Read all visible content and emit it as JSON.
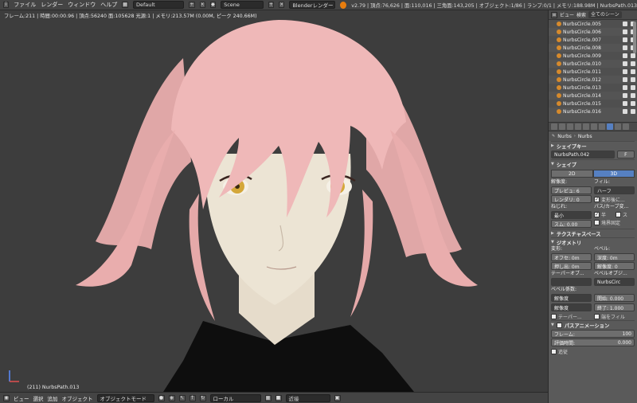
{
  "top": {
    "menus": [
      "ファイル",
      "レンダー",
      "ウィンドウ",
      "ヘルプ"
    ],
    "layout": "Default",
    "scene": "Scene",
    "engine": "Blenderレンダー",
    "stats": "v2.79 | 頂点:76,626 | 面:110,016 | 三角面:143,205 | オブジェクト:1/86 | ランプ:0/1 | メモリ:188.98M | NurbsPath.013"
  },
  "viewport": {
    "info": "フレーム:211 | 時間:00:00.96 | 頂点:56240 面:105628 光源:1 | メモリ:213.57M (0.00M, ピーク 240.66M)",
    "object_label": "(211) NurbsPath.013"
  },
  "bottom": {
    "menus": [
      "ビュー",
      "選択",
      "追加",
      "オブジェクト"
    ],
    "mode": "オブジェクトモード",
    "orientation": "ローカル",
    "snap": "近接"
  },
  "outliner": {
    "menus": [
      "ビュー",
      "検索"
    ],
    "scene_filter": "全てのシーン",
    "items": [
      "NurbsCircle.005",
      "NurbsCircle.006",
      "NurbsCircle.007",
      "NurbsCircle.008",
      "NurbsCircle.009",
      "NurbsCircle.010",
      "NurbsCircle.011",
      "NurbsCircle.012",
      "NurbsCircle.013",
      "NurbsCircle.014",
      "NurbsCircle.015",
      "NurbsCircle.016"
    ]
  },
  "properties": {
    "breadcrumb": [
      "Nurbs",
      "Nurbs"
    ],
    "shape_keys": "シェイプキー",
    "data_name": "NurbsPath.042",
    "data_f": "F",
    "shape": "シェイプ",
    "dim_2d": "2D",
    "dim_3d": "3D",
    "resolution": "解像度:",
    "preview": "プレビュ: 6",
    "render": "レンダリ: 0",
    "fill": "フィル:",
    "fill_value": "ハーフ",
    "fill_deform": "変形後に...",
    "twist": "ねじれ:",
    "twist_value": "最小",
    "smooth": "スム: 0.00",
    "path_curve": "パス/カーブ変...",
    "radius": "半",
    "stretch": "ス",
    "bounds": "境界固定",
    "texture_space": "テクスチャスペース",
    "geometry": "ジオメトリ",
    "modify": "変形:",
    "offset": "オフセ: 0m",
    "extrude": "押し出: 0m",
    "bevel": "ベベル:",
    "depth": "深度: 0m",
    "res": "解像度: 0",
    "taper": "テーパーオブ...",
    "bevel_obj": "ベベルオブジ...",
    "bevel_obj_val": "NurbsCirc",
    "bevel_factor": "ベベル係数:",
    "res2": "解像度",
    "start": "開始: 0.000",
    "res3": "解像度",
    "end": "終了: 1.000",
    "taper2": "テーパー...",
    "fill_caps": "端をフィル",
    "path_anim": "パスアニメーション",
    "frames": "フレーム:",
    "frames_val": "100",
    "eval_time": "評価時間:",
    "eval_val": "0.000",
    "follow": "追従"
  }
}
